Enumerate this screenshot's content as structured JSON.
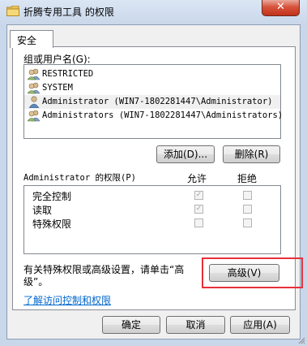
{
  "window": {
    "title": "折腾专用工具 的权限",
    "close_glyph": "✕"
  },
  "tabs": [
    {
      "label": "安全"
    }
  ],
  "groups": {
    "label": "组或用户名(G):",
    "items": [
      {
        "name": "RESTRICTED",
        "icon": "users-group-icon",
        "selected": false
      },
      {
        "name": "SYSTEM",
        "icon": "users-group-icon",
        "selected": false
      },
      {
        "name": "Administrator (WIN7-1802281447\\Administrator)",
        "icon": "user-icon",
        "selected": true
      },
      {
        "name": "Administrators (WIN7-1802281447\\Administrators)",
        "icon": "users-group-icon",
        "selected": false
      }
    ]
  },
  "buttons": {
    "add": "添加(D)...",
    "remove": "删除(R)",
    "advanced": "高级(V)",
    "ok": "确定",
    "cancel": "取消",
    "apply": "应用(A)"
  },
  "permissions": {
    "header": "Administrator 的权限(P)",
    "allow_label": "允许",
    "deny_label": "拒绝",
    "rows": [
      {
        "name": "完全控制",
        "allow": true,
        "deny": false
      },
      {
        "name": "读取",
        "allow": true,
        "deny": false
      },
      {
        "name": "特殊权限",
        "allow": false,
        "deny": false
      }
    ]
  },
  "advanced_note": "有关特殊权限或高级设置，请单击“高级”。",
  "advanced_note_line1": "有关特殊权限或高级设置，请单击“高",
  "advanced_note_line2": "级”。",
  "help_link": "了解访问控制和权限",
  "colors": {
    "highlight_box": "#e8303a",
    "link": "#0066cc",
    "close_button": "#c2321a"
  }
}
